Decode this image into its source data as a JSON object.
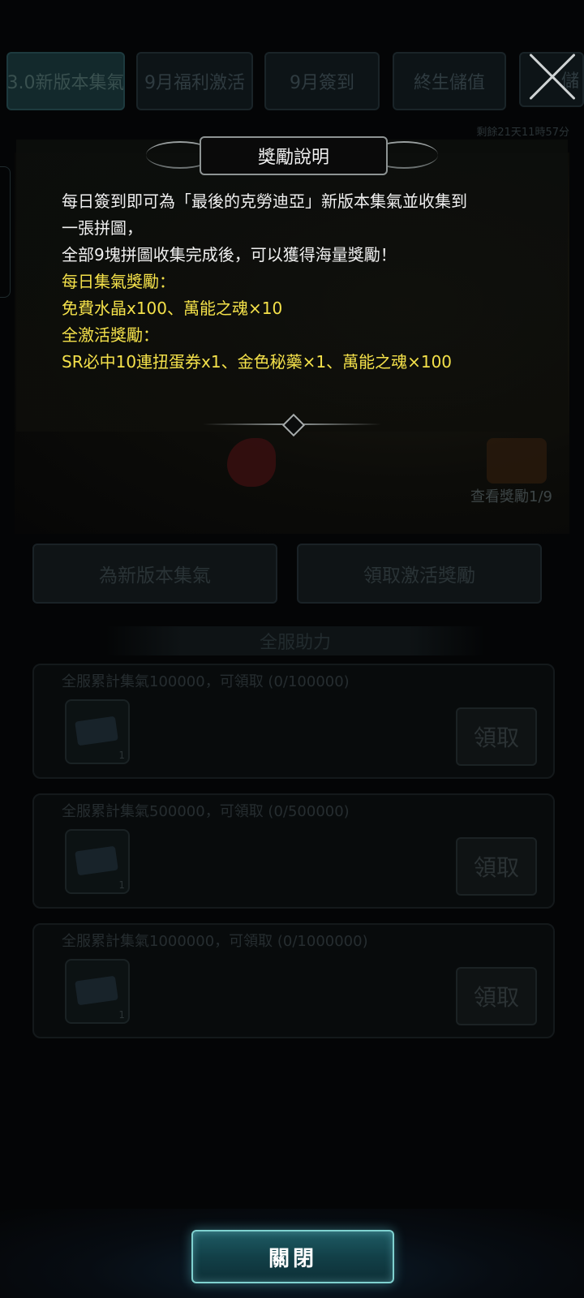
{
  "tabs": [
    {
      "label": "3.0新版本集氣",
      "active": true
    },
    {
      "label": "9月福利激活",
      "active": false
    },
    {
      "label": "9月簽到",
      "active": false
    },
    {
      "label": "終生儲值",
      "active": false
    },
    {
      "label": "儲",
      "active": false
    }
  ],
  "remaining_time": "剩餘21天11時57分",
  "banner": {
    "view_reward": "查看獎勵1/9"
  },
  "actions": {
    "collect": "為新版本集氣",
    "claim_activation": "領取激活獎勵"
  },
  "server_help": {
    "title": "全服助力"
  },
  "server_rewards": [
    {
      "title": "全服累計集氣100000，可領取 (0/100000)",
      "qty": "1",
      "button": "領取"
    },
    {
      "title": "全服累計集氣500000，可領取 (0/500000)",
      "qty": "1",
      "button": "領取"
    },
    {
      "title": "全服累計集氣1000000，可領取 (0/1000000)",
      "qty": "1",
      "button": "領取"
    }
  ],
  "dialog": {
    "title": "獎勵說明",
    "lines": [
      {
        "text": "每日簽到即可為「最後的克勞迪亞」新版本集氣並收集到",
        "color": "white"
      },
      {
        "text": "一張拼圖，",
        "color": "white"
      },
      {
        "text": "全部9塊拼圖收集完成後，可以獲得海量獎勵！",
        "color": "white"
      },
      {
        "text": "每日集氣獎勵：",
        "color": "yellow"
      },
      {
        "text": "免費水晶x100、萬能之魂×10",
        "color": "yellow"
      },
      {
        "text": "全激活獎勵：",
        "color": "yellow"
      },
      {
        "text": "SR必中10連扭蛋券x1、金色秘藥×1、萬能之魂×100",
        "color": "yellow"
      }
    ]
  },
  "close_button": {
    "label": "關閉"
  },
  "colors": {
    "highlight": "#f4e14a",
    "accent": "#7fd1cf"
  }
}
